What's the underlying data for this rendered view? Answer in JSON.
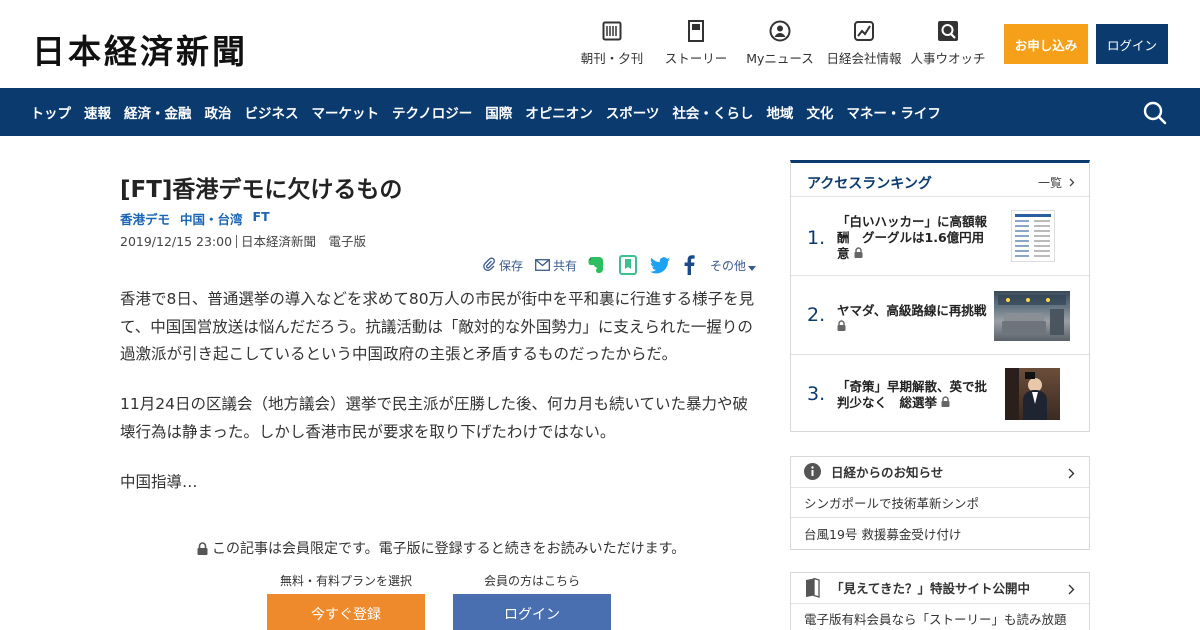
{
  "header": {
    "logo": "日本経済新聞",
    "nav": [
      {
        "label": "朝刊・夕刊",
        "icon": "newspaper-icon"
      },
      {
        "label": "ストーリー",
        "icon": "story-icon"
      },
      {
        "label": "Myニュース",
        "icon": "person-icon"
      },
      {
        "label": "日経会社情報",
        "icon": "chart-icon"
      },
      {
        "label": "人事ウオッチ",
        "icon": "search-person-icon"
      }
    ],
    "apply_label": "お申し込み",
    "login_label": "ログイン"
  },
  "category_nav": [
    "トップ",
    "速報",
    "経済・金融",
    "政治",
    "ビジネス",
    "マーケット",
    "テクノロジー",
    "国際",
    "オピニオン",
    "スポーツ",
    "社会・くらし",
    "地域",
    "文化",
    "マネー・ライフ"
  ],
  "article": {
    "title": "[FT]香港デモに欠けるもの",
    "tags": [
      "香港デモ",
      "中国・台湾",
      "FT"
    ],
    "date": "2019/12/15 23:00",
    "source": "日本経済新聞　電子版",
    "tools": {
      "save": "保存",
      "share": "共有",
      "more": "その他"
    },
    "paragraphs": [
      "香港で8日、普通選挙の導入などを求めて80万人の市民が街中を平和裏に行進する様子を見て、中国国営放送は悩んだだろう。抗議活動は「敵対的な外国勢力」に支えられた一握りの過激派が引き起こしているという中国政府の主張と矛盾するものだったからだ。",
      "11月24日の区議会（地方議会）選挙で民主派が圧勝した後、何カ月も続いていた暴力や破壊行為は静まった。しかし香港市民が要求を取り下げたわけではない。",
      "中国指導…"
    ],
    "paywall": {
      "note": "この記事は会員限定です。電子版に登録すると続きをお読みいただけます。",
      "plan_label": "無料・有料プランを選択",
      "member_label": "会員の方はこちら",
      "register_button": "今すぐ登録",
      "login_button": "ログイン"
    }
  },
  "ranking": {
    "title": "アクセスランキング",
    "all_label": "一覧",
    "items": [
      {
        "rank": "1.",
        "text": "「白いハッカー」に高額報酬　グーグルは1.6億円用意"
      },
      {
        "rank": "2.",
        "text": "ヤマダ、高級路線に再挑戦"
      },
      {
        "rank": "3.",
        "text": "「奇策」早期解散、英で批判少なく　総選挙"
      }
    ]
  },
  "notices": {
    "title": "日経からのお知らせ",
    "items": [
      "シンガポールで技術革新シンポ",
      "台風19号 救援募金受け付け"
    ]
  },
  "promo": {
    "title": "「見えてきた？」特設サイト公開中",
    "items": [
      "電子版有料会員なら「ストーリー」も読み放題"
    ]
  },
  "colors": {
    "navy": "#0a3a6e",
    "orange": "#f5a018",
    "link_blue": "#1a66b5",
    "login_blue": "#4a6fb0"
  }
}
